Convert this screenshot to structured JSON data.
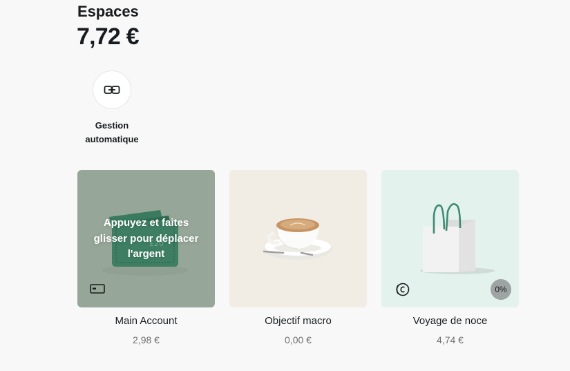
{
  "header": {
    "title": "Espaces",
    "total": "7,72 €"
  },
  "auto_management": {
    "label_line1": "Gestion",
    "label_line2": "automatique",
    "icon": "link-icon"
  },
  "spaces": [
    {
      "name": "Main Account",
      "amount": "2,98 €",
      "overlay_line1": "Appuyez et faites",
      "overlay_line2": "glisser pour déplacer",
      "overlay_line3": "l'argent",
      "icon": "card-icon",
      "image": "wallet-with-cash",
      "background": "#96a698"
    },
    {
      "name": "Objectif macro",
      "amount": "0,00 €",
      "image": "coffee-cup",
      "background": "#f2ede4"
    },
    {
      "name": "Voyage de noce",
      "amount": "4,74 €",
      "icon": "coin-icon",
      "badge": "0%",
      "image": "shopping-bag",
      "background": "#e4f2ee"
    }
  ]
}
